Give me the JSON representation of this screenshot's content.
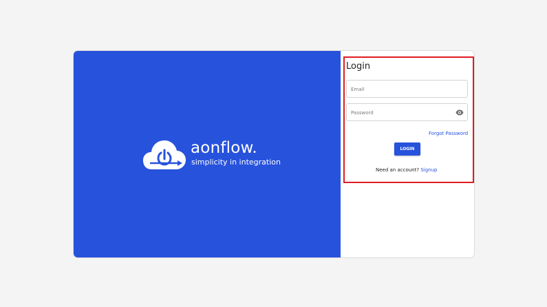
{
  "brand": {
    "name": "aonflow.",
    "tagline": "simplicity in integration",
    "icon": "cloud-power-icon"
  },
  "login": {
    "title": "Login",
    "email_placeholder": "Email",
    "email_value": "",
    "password_placeholder": "Password",
    "password_value": "",
    "password_toggle_icon": "eye-icon",
    "forgot_password": "Forgot Password",
    "login_button": "LOGIN",
    "signup_prompt": "Need an account?",
    "signup_link": "Signup"
  },
  "colors": {
    "brand_blue": "#2752dc",
    "highlight": "#e01b24",
    "background": "#f4f4f4"
  }
}
